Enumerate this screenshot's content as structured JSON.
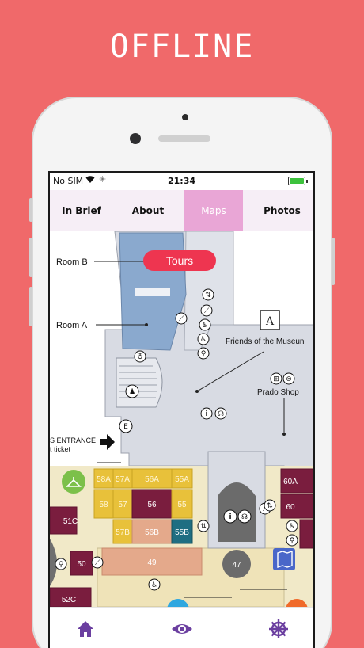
{
  "banner": {
    "title": "OFFLINE"
  },
  "status_bar": {
    "carrier": "No SIM",
    "time": "21:34"
  },
  "tabs": [
    {
      "label": "In Brief"
    },
    {
      "label": "About"
    },
    {
      "label": "Maps"
    },
    {
      "label": "Photos"
    }
  ],
  "active_tab": "Maps",
  "map": {
    "tours_button": "Tours",
    "labels": {
      "room_b": "Room B",
      "room_a": "Room A",
      "friends": "Friends of the Museun",
      "prado_shop": "Prado Shop",
      "entrance_line1": "S ENTRANCE",
      "entrance_line2": "t ticket",
      "entrance_marker": "E"
    },
    "rooms": {
      "r58a": "58A",
      "r57a": "57A",
      "r56a": "56A",
      "r55a": "55A",
      "r58": "58",
      "r57": "57",
      "r56": "56",
      "r55": "55",
      "r57b": "57B",
      "r56b": "56B",
      "r55b": "55B",
      "r49": "49",
      "r47": "47",
      "r50": "50",
      "r51c": "51C",
      "r52c": "52C",
      "r60a": "60A",
      "r60": "60"
    }
  },
  "bottom_nav": [
    {
      "name": "home-icon"
    },
    {
      "name": "eye-icon"
    },
    {
      "name": "ship-wheel-icon"
    }
  ],
  "colors": {
    "background": "#f0696a",
    "active_tab": "#e9a6d6",
    "tours_button": "#ee3550",
    "nav_icon": "#6b3fa0"
  }
}
